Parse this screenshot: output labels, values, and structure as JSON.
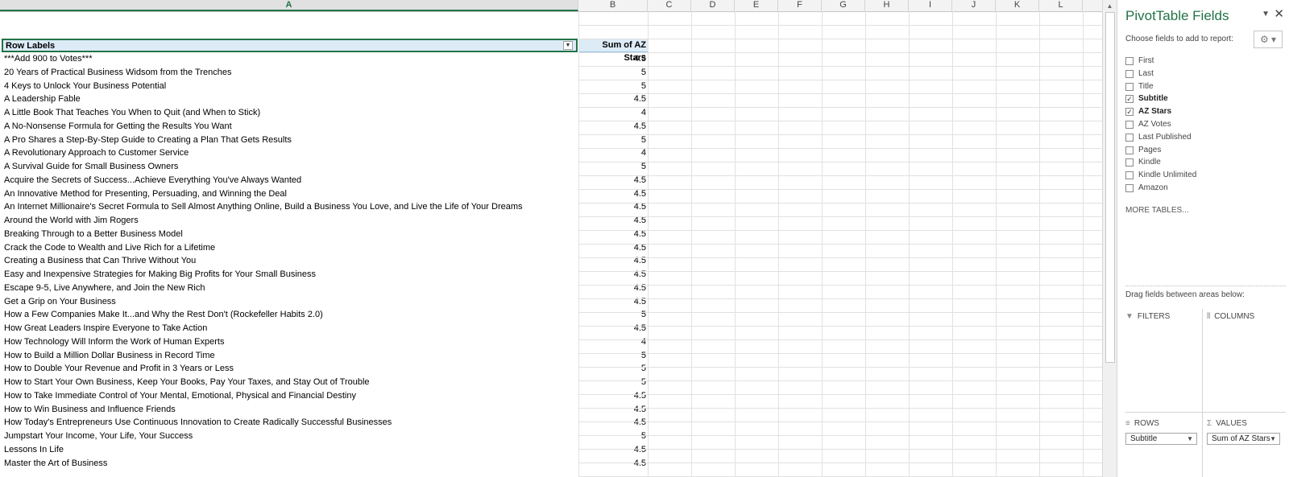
{
  "columns": [
    "A",
    "B",
    "C",
    "D",
    "E",
    "F",
    "G",
    "H",
    "I",
    "J",
    "K",
    "L"
  ],
  "pivot": {
    "header_row_labels": "Row Labels",
    "header_values": "Sum of AZ Stars",
    "rows": [
      {
        "label": "***Add 900 to Votes***",
        "value": "4.5"
      },
      {
        "label": "20 Years of Practical Business Widsom from the Trenches",
        "value": "5"
      },
      {
        "label": "4 Keys to Unlock Your Business Potential",
        "value": "5"
      },
      {
        "label": "A Leadership Fable",
        "value": "4.5"
      },
      {
        "label": "A Little Book That Teaches You When to Quit (and When to Stick)",
        "value": "4"
      },
      {
        "label": "A No-Nonsense Formula for Getting the Results You Want",
        "value": "4.5"
      },
      {
        "label": "A Pro Shares a Step-By-Step Guide to Creating a Plan That Gets Results",
        "value": "5"
      },
      {
        "label": "A Revolutionary Approach to Customer Service",
        "value": "4"
      },
      {
        "label": "A Survival Guide for Small Business Owners",
        "value": "5"
      },
      {
        "label": "Acquire the Secrets of Success...Achieve Everything You've Always Wanted",
        "value": "4.5"
      },
      {
        "label": "An Innovative Method for Presenting, Persuading, and Winning the Deal",
        "value": "4.5"
      },
      {
        "label": "An Internet Millionaire's Secret Formula to Sell Almost Anything Online, Build a Business You Love, and Live the Life of Your Dreams",
        "value": "4.5"
      },
      {
        "label": "Around the World with Jim Rogers",
        "value": "4.5"
      },
      {
        "label": "Breaking Through to a Better Business Model",
        "value": "4.5"
      },
      {
        "label": "Crack the Code to Wealth and Live Rich for a Lifetime",
        "value": "4.5"
      },
      {
        "label": "Creating a Business that Can Thrive Without You",
        "value": "4.5"
      },
      {
        "label": "Easy and Inexpensive Strategies for Making Big Profits for Your Small Business",
        "value": "4.5"
      },
      {
        "label": "Escape 9-5, Live Anywhere, and Join the New Rich",
        "value": "4.5"
      },
      {
        "label": "Get a Grip on Your Business",
        "value": "4.5"
      },
      {
        "label": "How a Few Companies Make It...and Why the Rest Don't (Rockefeller Habits 2.0)",
        "value": "5"
      },
      {
        "label": "How Great Leaders Inspire Everyone to Take Action",
        "value": "4.5"
      },
      {
        "label": "How Technology Will Inform the Work of Human Experts",
        "value": "4"
      },
      {
        "label": "How to Build a Million Dollar Business in Record Time",
        "value": "5"
      },
      {
        "label": "How to Double Your Revenue and Profit in 3 Years or Less",
        "value": "5"
      },
      {
        "label": "How to Start Your Own Business, Keep Your Books, Pay Your Taxes, and Stay Out of Trouble",
        "value": "5"
      },
      {
        "label": "How to Take Immediate Control of Your Mental, Emotional, Physical and Financial Destiny",
        "value": "4.5"
      },
      {
        "label": "How to Win Business and Influence Friends",
        "value": "4.5"
      },
      {
        "label": "How Today's Entrepreneurs Use Continuous Innovation to Create Radically Successful Businesses",
        "value": "4.5"
      },
      {
        "label": "Jumpstart Your Income, Your Life, Your Success",
        "value": "5"
      },
      {
        "label": "Lessons In Life",
        "value": "4.5"
      },
      {
        "label": "Master the Art of Business",
        "value": "4.5"
      }
    ]
  },
  "pane": {
    "title": "PivotTable Fields",
    "choose_label": "Choose fields to add to report:",
    "fields": [
      {
        "name": "First",
        "checked": false
      },
      {
        "name": "Last",
        "checked": false
      },
      {
        "name": "Title",
        "checked": false
      },
      {
        "name": "Subtitle",
        "checked": true
      },
      {
        "name": "AZ Stars",
        "checked": true
      },
      {
        "name": "AZ Votes",
        "checked": false
      },
      {
        "name": "Last Published",
        "checked": false
      },
      {
        "name": "Pages",
        "checked": false
      },
      {
        "name": "Kindle",
        "checked": false
      },
      {
        "name": "Kindle Unlimited",
        "checked": false
      },
      {
        "name": "Amazon",
        "checked": false
      }
    ],
    "more_tables": "MORE TABLES...",
    "drag_label": "Drag fields between areas below:",
    "areas": {
      "filters": "FILTERS",
      "columns": "COLUMNS",
      "rows": "ROWS",
      "values": "VALUES"
    },
    "rows_field": "Subtitle",
    "values_field": "Sum of AZ Stars"
  }
}
